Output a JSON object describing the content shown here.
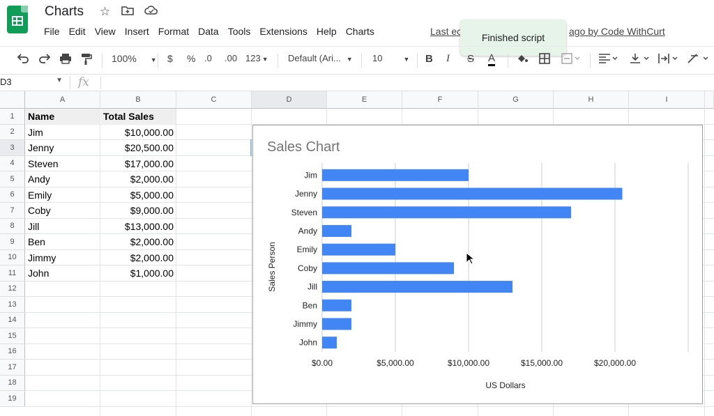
{
  "app": {
    "title": "Charts",
    "icons": [
      "star-icon",
      "move-to-folder-icon",
      "cloud-status-icon"
    ]
  },
  "menu": [
    "File",
    "Edit",
    "View",
    "Insert",
    "Format",
    "Data",
    "Tools",
    "Extensions",
    "Help",
    "Charts"
  ],
  "last_edit_prefix": "Last ec",
  "last_edit_suffix": "ago by Code WithCurt",
  "toast": "Finished script",
  "toolbar": {
    "zoom": "100%",
    "currency": "$",
    "percent": "%",
    "decrease_decimal": ".0",
    "increase_decimal": ".00",
    "more_formats": "123",
    "font": "Default (Ari...",
    "font_size": "10",
    "bold": "B",
    "italic": "I",
    "strike": "S",
    "text_color": "A"
  },
  "formula_bar": {
    "name_box": "D3",
    "fx": "fx"
  },
  "grid": {
    "columns": [
      "A",
      "B",
      "C",
      "D",
      "E",
      "F",
      "G",
      "H",
      "I"
    ],
    "rows": [
      "1",
      "2",
      "3",
      "4",
      "5",
      "6",
      "7",
      "8",
      "9",
      "10",
      "11",
      "12",
      "13",
      "14",
      "15",
      "16",
      "17",
      "18",
      "19"
    ],
    "header": {
      "name": "Name",
      "total": "Total Sales"
    },
    "data": [
      {
        "name": "Jim",
        "total": "$10,000.00"
      },
      {
        "name": "Jenny",
        "total": "$20,500.00"
      },
      {
        "name": "Steven",
        "total": "$17,000.00"
      },
      {
        "name": "Andy",
        "total": "$2,000.00"
      },
      {
        "name": "Emily",
        "total": "$5,000.00"
      },
      {
        "name": "Coby",
        "total": "$9,000.00"
      },
      {
        "name": "Jill",
        "total": "$13,000.00"
      },
      {
        "name": "Ben",
        "total": "$2,000.00"
      },
      {
        "name": "Jimmy",
        "total": "$2,000.00"
      },
      {
        "name": "John",
        "total": "$1,000.00"
      }
    ]
  },
  "chart_data": {
    "type": "bar",
    "orientation": "horizontal",
    "title": "Sales Chart",
    "xlabel": "US Dollars",
    "ylabel": "Sales Person",
    "categories": [
      "Jim",
      "Jenny",
      "Steven",
      "Andy",
      "Emily",
      "Coby",
      "Jill",
      "Ben",
      "Jimmy",
      "John"
    ],
    "values": [
      10000,
      20500,
      17000,
      2000,
      5000,
      9000,
      13000,
      2000,
      2000,
      1000
    ],
    "xticks": [
      "$0.00",
      "$5,000.00",
      "$10,000.00",
      "$15,000.00",
      "$20,000.00"
    ],
    "xtick_values": [
      0,
      5000,
      10000,
      15000,
      20000
    ],
    "xlim": [
      0,
      25000
    ],
    "grid": true,
    "bar_color": "#4285f4"
  }
}
